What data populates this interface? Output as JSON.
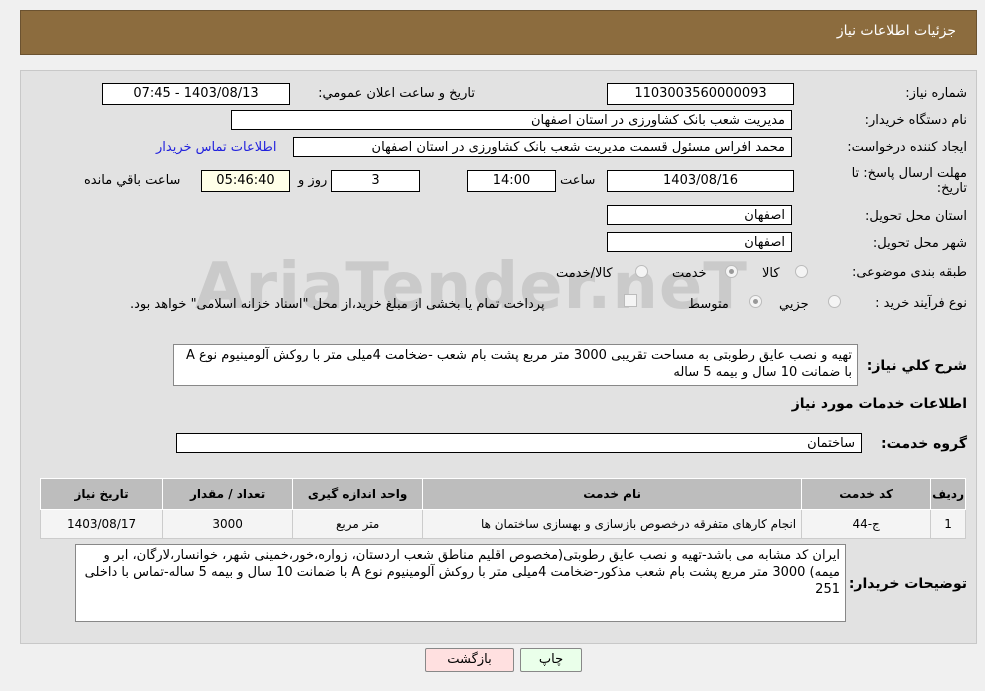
{
  "header": {
    "title": "جزئیات اطلاعات نیاز"
  },
  "form": {
    "need_number_label": "شماره نیاز:",
    "need_number": "1103003560000093",
    "announce_label": "تاریخ و ساعت اعلان عمومي:",
    "announce_value": "1403/08/13 - 07:45",
    "buyer_label": "نام دستگاه خریدار:",
    "buyer_value": "مدیریت شعب بانک کشاورزی در استان اصفهان",
    "creator_label": "ایجاد کننده درخواست:",
    "creator_value": "محمد افراس مسئول قسمت مدیریت شعب بانک کشاورزی در استان اصفهان",
    "contact_link": "اطلاعات تماس خریدار",
    "deadline_label": "مهلت ارسال پاسخ: تا تاریخ:",
    "deadline_date": "1403/08/16",
    "time_label": "ساعت",
    "deadline_time": "14:00",
    "days": "3",
    "days_label": "روز و",
    "remaining": "05:46:40",
    "remaining_label": "ساعت باقي مانده",
    "province_label": "استان محل تحویل:",
    "province": "اصفهان",
    "city_label": "شهر محل تحویل:",
    "city": "اصفهان",
    "category_label": "طبقه بندی موضوعی:",
    "category_options": [
      "کالا",
      "خدمت",
      "کالا/خدمت"
    ],
    "category_selected": "خدمت",
    "process_label": "نوع فرآیند خرید :",
    "process_options": [
      "جزيي",
      "متوسط"
    ],
    "process_selected": "متوسط",
    "payment_note": "پرداخت تمام یا بخشی از مبلغ خرید،از محل \"اسناد خزانه اسلامی\" خواهد بود.",
    "description_label": "شرح کلي نیاز:",
    "description": "تهیه و نصب عایق رطوبتی به مساحت تقریبی 3000 متر مربع پشت بام شعب -ضخامت 4میلی متر با روکش آلومینیوم نوع A با ضمانت 10 سال و بیمه 5 ساله"
  },
  "services": {
    "section_title": "اطلاعات خدمات مورد نیاز",
    "group_label": "گروه خدمت:",
    "group_value": "ساختمان",
    "columns": [
      "ردیف",
      "کد خدمت",
      "نام خدمت",
      "واحد اندازه گیری",
      "تعداد / مقدار",
      "تاریخ نیاز"
    ],
    "rows": [
      [
        "1",
        "ج-44",
        "انجام کارهای متفرقه درخصوص بازسازی و بهسازی ساختمان ها",
        "متر مربع",
        "3000",
        "1403/08/17"
      ]
    ]
  },
  "buyer_notes": {
    "label": "توضیحات خریدار:",
    "text": "ایران کد مشابه می باشد-تهیه و نصب عایق رطوبتی(مخصوص اقلیم  مناطق شعب اردستان، زواره،خور،خمینی شهر، خوانسار،لارگان، ابر و میمه)  3000 متر مربع پشت بام شعب مذکور-ضخامت 4میلی متر با روکش آلومینیوم نوع A با ضمانت 10 سال و بیمه 5 ساله-تماس با داخلی 251"
  },
  "buttons": {
    "print": "چاپ",
    "back": "بازگشت"
  },
  "watermark": "AriaTender.neT"
}
